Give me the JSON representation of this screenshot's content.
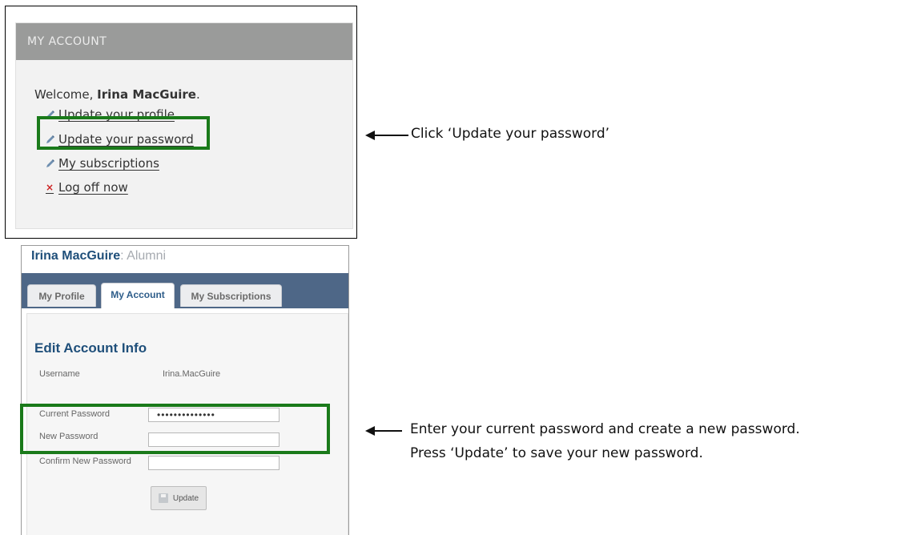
{
  "account_widget": {
    "header": "MY ACCOUNT",
    "welcome_prefix": "Welcome,",
    "user_name": "Irina MacGuire",
    "welcome_suffix": ".",
    "links": [
      {
        "label": "Update your profile",
        "icon": "pencil-icon"
      },
      {
        "label": "Update your password",
        "icon": "pencil-icon"
      },
      {
        "label": "My subscriptions",
        "icon": "pencil-icon"
      },
      {
        "label": "Log off now",
        "icon": "x-icon"
      }
    ]
  },
  "profile_page": {
    "user_name": "Irina MacGuire",
    "role": ": Alumni",
    "tabs": [
      {
        "label": "My Profile",
        "active": false
      },
      {
        "label": "My Account",
        "active": true
      },
      {
        "label": "My Subscriptions",
        "active": false
      }
    ],
    "section_title": "Edit Account Info",
    "username_label": "Username",
    "username_value": "Irina.MacGuire",
    "current_password_label": "Current Password",
    "current_password_value": "••••••••••••••",
    "new_password_label": "New Password",
    "new_password_value": "",
    "confirm_password_label": "Confirm New Password",
    "confirm_password_value": "",
    "update_button": "Update"
  },
  "annotations": {
    "step1": "Click ‘Update your password’",
    "step2_line1": "Enter your current password and create a new password.",
    "step2_line2": "Press ‘Update’ to save your new password."
  },
  "colors": {
    "highlight": "#1a7a1a",
    "header_gray": "#9a9b9a",
    "tabbar_blue": "#4e6787",
    "title_blue": "#1f4f7a"
  }
}
